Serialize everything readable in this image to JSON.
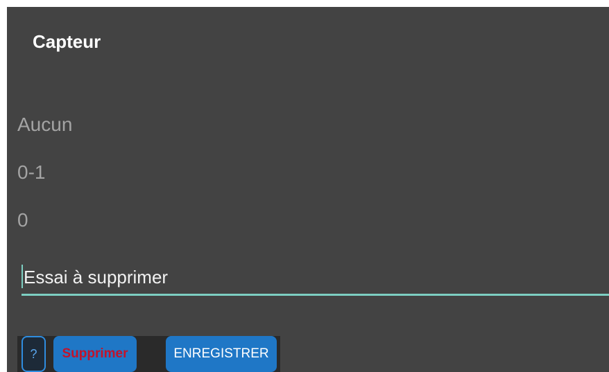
{
  "dialog": {
    "title": "Capteur",
    "fields": [
      "Aucun",
      "0-1",
      "0"
    ],
    "name_input": {
      "value": "Essai à supprimer"
    },
    "buttons": {
      "help_label": "?",
      "delete_label": "Supprimer",
      "save_label": "ENREGISTRER"
    }
  },
  "colors": {
    "dialog_background": "#434343",
    "accent": "#7dcfc2",
    "button_blue": "#1f77c6",
    "delete_text": "#c2132b"
  }
}
